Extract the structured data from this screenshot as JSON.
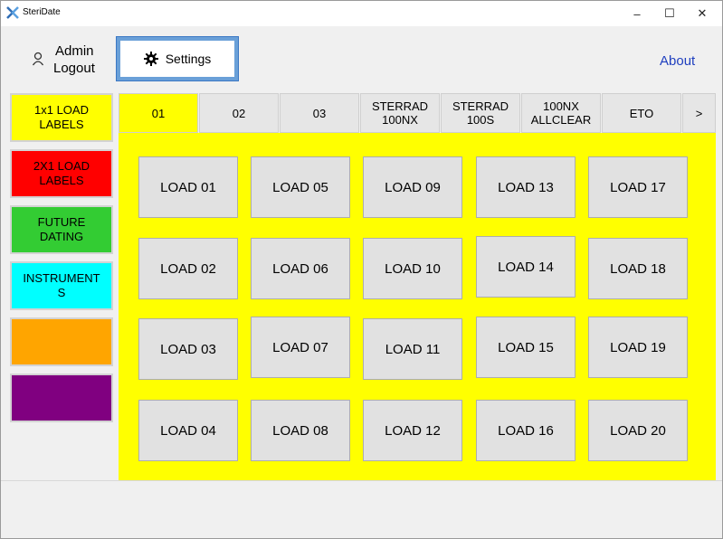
{
  "window": {
    "title": "SteriDate",
    "controls": {
      "minimize": "–",
      "maximize": "☐",
      "close": "✕"
    }
  },
  "header": {
    "user": "Admin",
    "logout": "Logout",
    "settings": "Settings",
    "about": "About"
  },
  "sidebar": {
    "items": [
      {
        "label_line1": "1x1 LOAD",
        "label_line2": "LABELS",
        "color": "#ffff00",
        "text_color": "#000000"
      },
      {
        "label_line1": "2X1 LOAD",
        "label_line2": "LABELS",
        "color": "#ff0000",
        "text_color": "#000000"
      },
      {
        "label_line1": "FUTURE",
        "label_line2": "DATING",
        "color": "#33cc33",
        "text_color": "#000000"
      },
      {
        "label_line1": "INSTRUMENT",
        "label_line2": "S",
        "color": "#00ffff",
        "text_color": "#000000"
      },
      {
        "label_line1": "",
        "label_line2": "",
        "color": "#ffa500",
        "text_color": "#000000"
      },
      {
        "label_line1": "",
        "label_line2": "",
        "color": "#800080",
        "text_color": "#000000"
      }
    ]
  },
  "tabs": [
    {
      "line1": "01",
      "line2": "",
      "active": true
    },
    {
      "line1": "02",
      "line2": ""
    },
    {
      "line1": "03",
      "line2": ""
    },
    {
      "line1": "STERRAD",
      "line2": "100NX"
    },
    {
      "line1": "STERRAD",
      "line2": "100S"
    },
    {
      "line1": "100NX",
      "line2": "ALLCLEAR"
    },
    {
      "line1": "ETO",
      "line2": ""
    },
    {
      "line1": ">",
      "line2": ""
    }
  ],
  "loads": [
    "LOAD 01",
    "LOAD 02",
    "LOAD 03",
    "LOAD 04",
    "LOAD 05",
    "LOAD 06",
    "LOAD 07",
    "LOAD 08",
    "LOAD 09",
    "LOAD 10",
    "LOAD 11",
    "LOAD 12",
    "LOAD 13",
    "LOAD 14",
    "LOAD 15",
    "LOAD 16",
    "LOAD 17",
    "LOAD 18",
    "LOAD 19",
    "LOAD 20"
  ],
  "colors": {
    "panel": "#ffff00",
    "active_tab": "#ffff00",
    "settings_border": "#6aa0d8",
    "about_link": "#1f3fbf"
  }
}
